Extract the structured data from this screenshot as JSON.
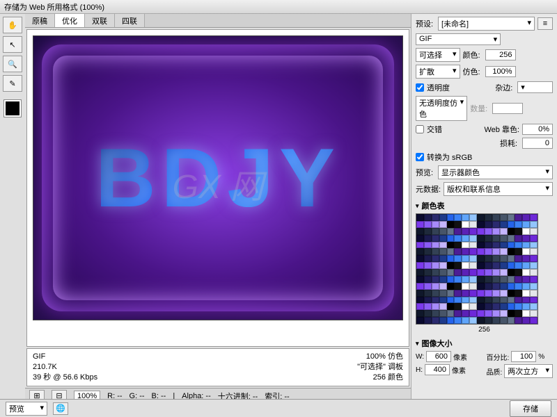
{
  "title": "存储为 Web 所用格式 (100%)",
  "tabs": [
    "原稿",
    "优化",
    "双联",
    "四联"
  ],
  "active_tab": 1,
  "canvas_text": "BDJY",
  "watermark": "GX 网",
  "info": {
    "format": "GIF",
    "size": "210.7K",
    "speed": "39 秒 @ 56.6 Kbps",
    "dither_pct": "100% 仿色",
    "palette": "\"可选择\" 调板",
    "colors": "256 颜色"
  },
  "statusbar": {
    "zoom": "100%",
    "r": "R: --",
    "g": "G: --",
    "b": "B: --",
    "alpha": "Alpha: --",
    "hex": "十六进制: --",
    "index": "索引: --"
  },
  "footer": {
    "preview": "预览",
    "save": "存储"
  },
  "panel": {
    "preset_label": "预设:",
    "preset_value": "[未命名]",
    "format": "GIF",
    "reduction": "可选择",
    "colors_label": "颜色:",
    "colors": "256",
    "dither": "扩散",
    "dither_label": "仿色:",
    "dither_pct": "100%",
    "transparency": "透明度",
    "matte_label": "杂边:",
    "no_trans_dither": "无透明度仿色",
    "amount_label": "数量:",
    "interlaced": "交错",
    "websnap_label": "Web 靠色:",
    "websnap": "0%",
    "lossy_label": "损耗:",
    "lossy": "0",
    "convert_srgb": "转换为 sRGB",
    "preview_label": "预览:",
    "preview_value": "显示器颜色",
    "metadata_label": "元数据:",
    "metadata_value": "版权和联系信息",
    "color_table": "颜色表",
    "ct_count": "256",
    "image_size": "图像大小",
    "w": "W:",
    "w_val": "600",
    "px": "像素",
    "h": "H:",
    "h_val": "400",
    "percent_label": "百分比:",
    "percent": "100",
    "quality_label": "品质:",
    "quality": "两次立方"
  }
}
